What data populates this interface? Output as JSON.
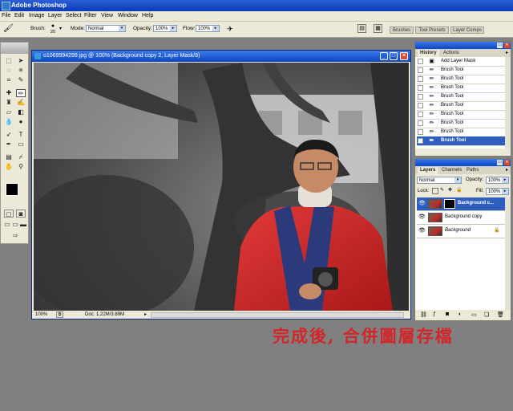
{
  "app_title": "Adobe Photoshop",
  "menu": [
    "File",
    "Edit",
    "Image",
    "Layer",
    "Select",
    "Filter",
    "View",
    "Window",
    "Help"
  ],
  "options": {
    "brush_label": "Brush:",
    "brush_size": "20",
    "mode_label": "Mode:",
    "mode_value": "Normal",
    "opacity_label": "Opacity:",
    "opacity_value": "100%",
    "flow_label": "Flow:",
    "flow_value": "100%",
    "well_tabs": [
      "Brushes",
      "Tool Presets",
      "Layer Comps"
    ]
  },
  "document": {
    "title": "o1069994299.jpg @ 100% (Background copy 2, Layer Mask/8)",
    "zoom": "100%",
    "doc_size": "Doc: 1.22M/3.89M"
  },
  "history": {
    "tabs": [
      "History",
      "Actions"
    ],
    "items": [
      "Add Layer Mask",
      "Brush Tool",
      "Brush Tool",
      "Brush Tool",
      "Brush Tool",
      "Brush Tool",
      "Brush Tool",
      "Brush Tool",
      "Brush Tool",
      "Brush Tool"
    ],
    "selected_index": 9
  },
  "layers": {
    "tabs": [
      "Layers",
      "Channels",
      "Paths"
    ],
    "blend_mode": "Normal",
    "opacity_label": "Opacity:",
    "opacity_value": "100%",
    "lock_label": "Lock:",
    "fill_label": "Fill:",
    "fill_value": "100%",
    "items": [
      "Background c...",
      "Background copy",
      "Background"
    ],
    "selected_index": 0
  },
  "caption": "完成後, 合併圖層存檔",
  "colors": {
    "accent": "#0b46c5",
    "caption": "#d2262a",
    "selected": "#2f5fbe"
  }
}
